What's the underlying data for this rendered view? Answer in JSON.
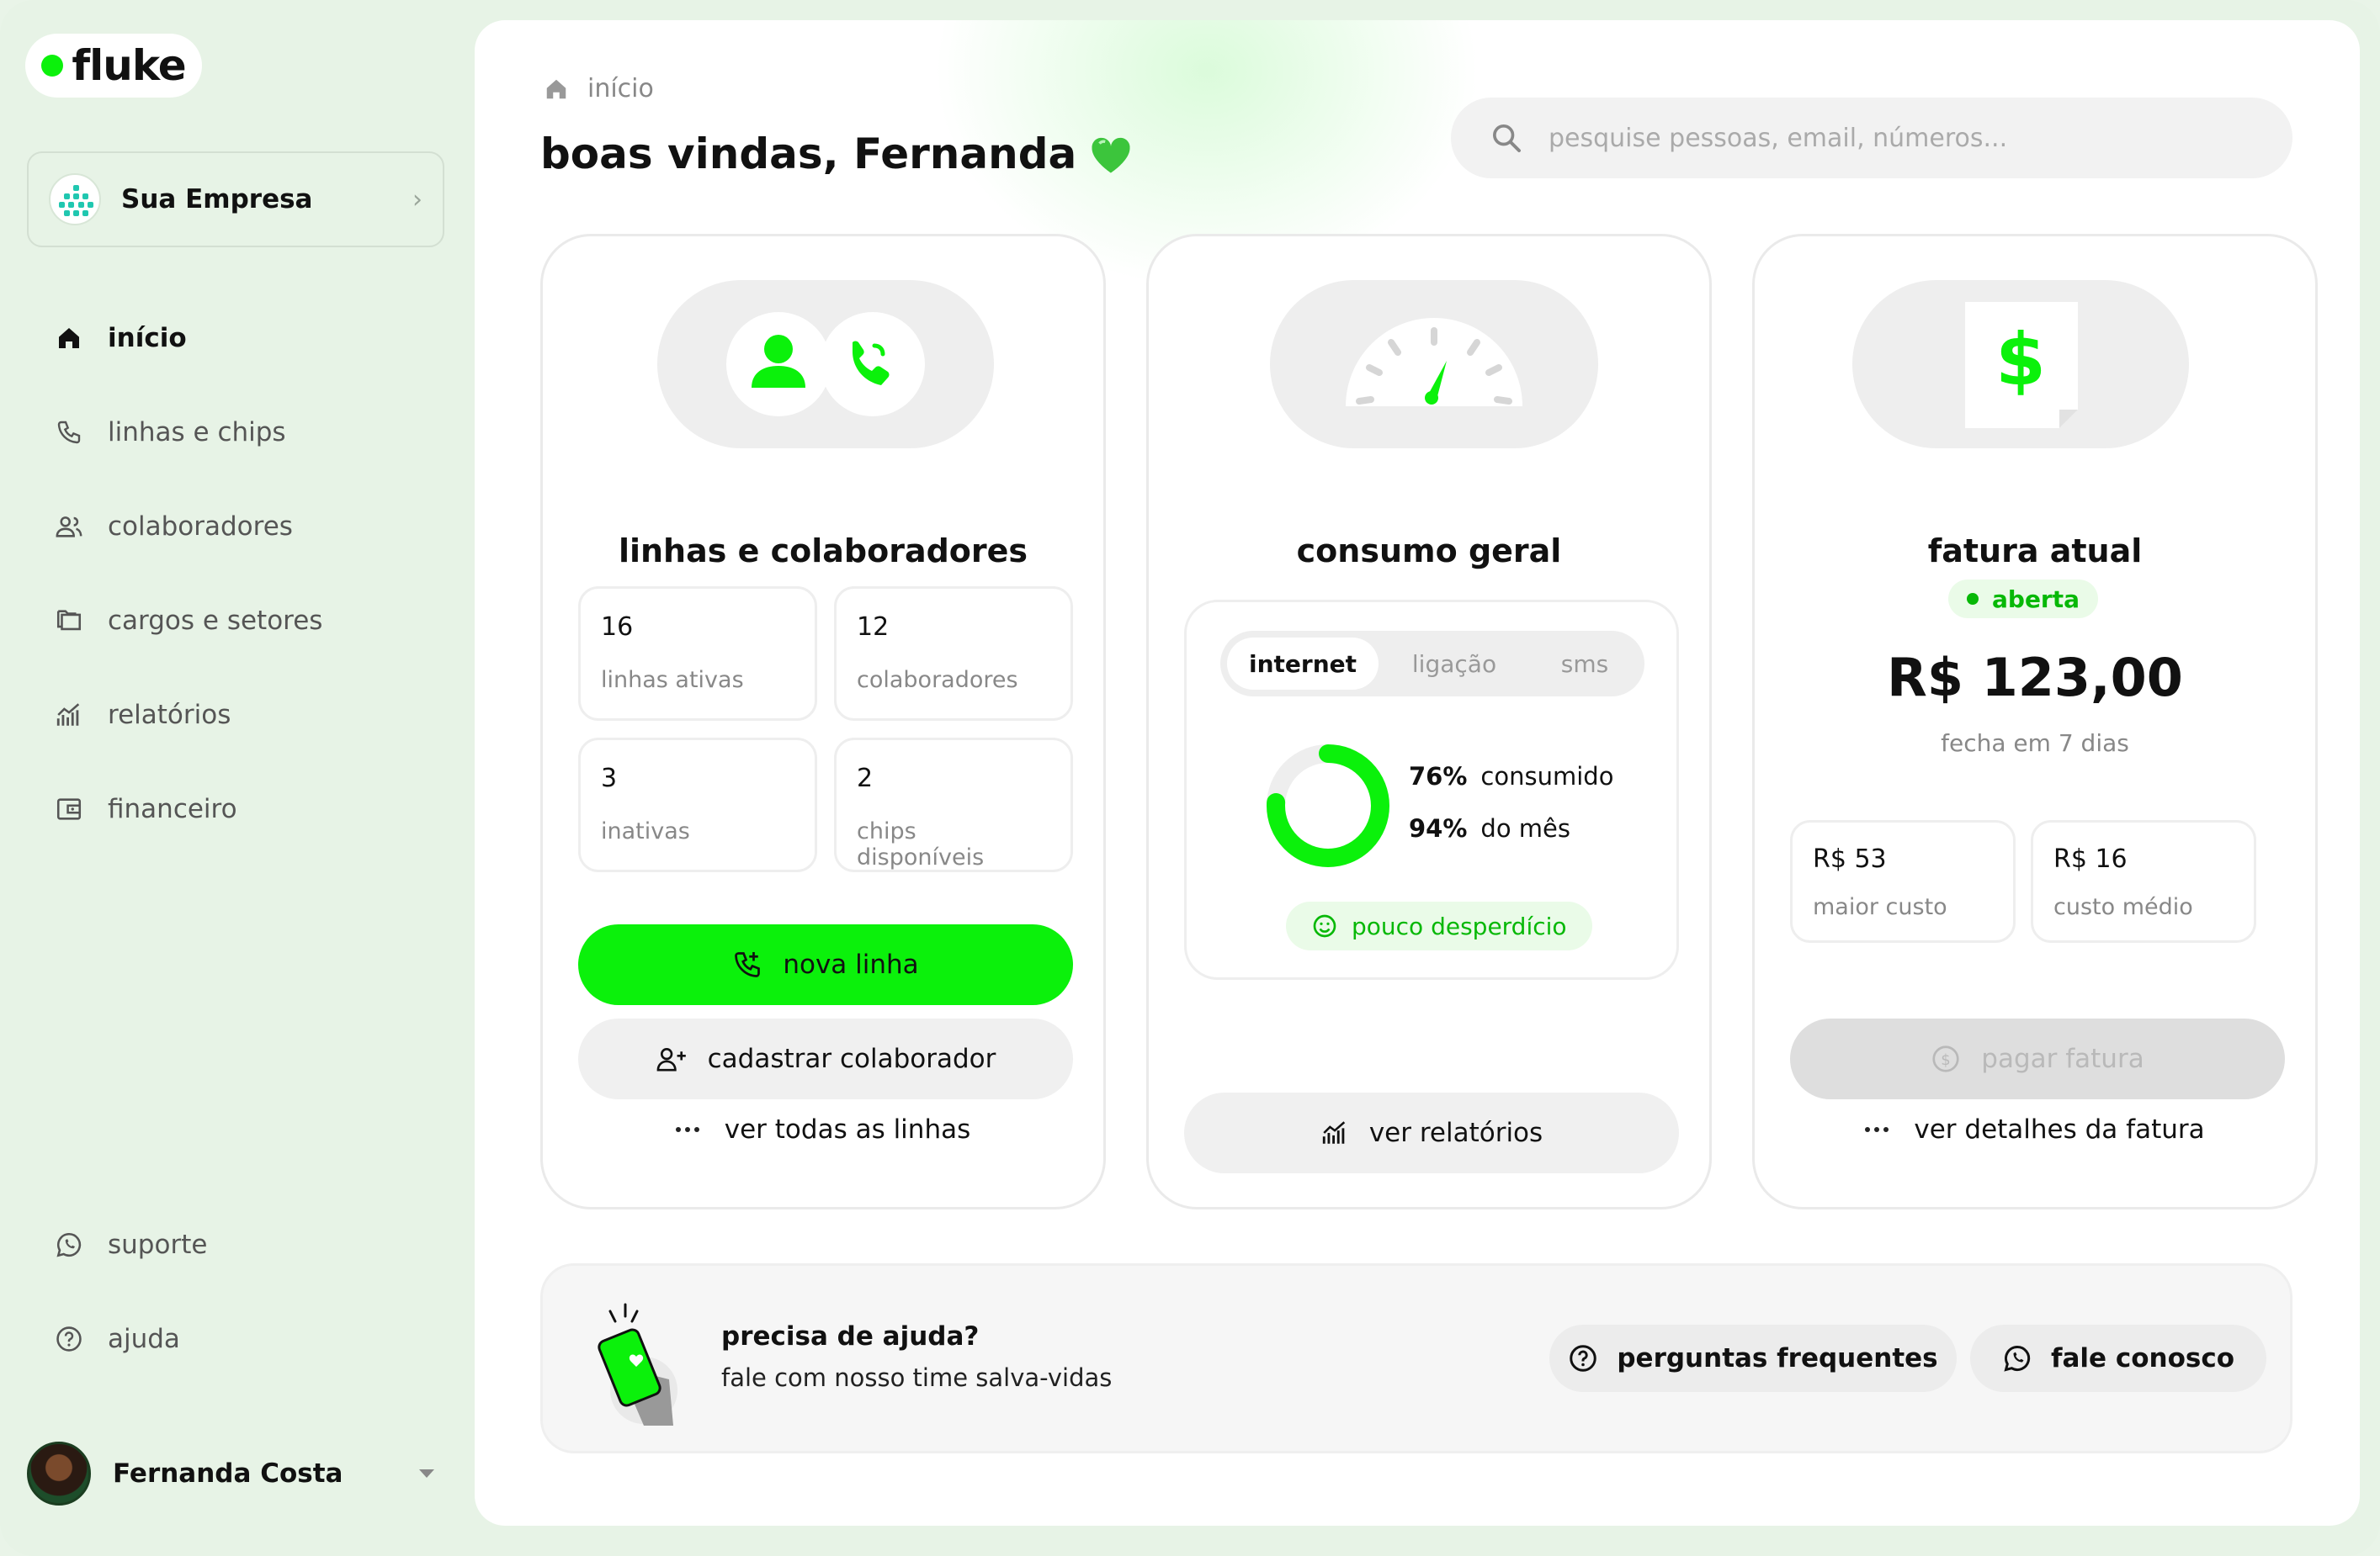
{
  "app": {
    "logo_text": "fluke"
  },
  "colors": {
    "accent": "#0bf10b",
    "accent_dark": "#07b807",
    "background": "#e7f3e6"
  },
  "sidebar": {
    "company": {
      "name": "Sua Empresa"
    },
    "items": [
      {
        "label": "início",
        "icon": "home-icon",
        "active": true
      },
      {
        "label": "linhas e chips",
        "icon": "phone-icon"
      },
      {
        "label": "colaboradores",
        "icon": "users-icon"
      },
      {
        "label": "cargos e setores",
        "icon": "folders-icon"
      },
      {
        "label": "relatórios",
        "icon": "chart-icon"
      },
      {
        "label": "financeiro",
        "icon": "wallet-icon"
      }
    ],
    "bottom_items": [
      {
        "label": "suporte",
        "icon": "whatsapp-icon"
      },
      {
        "label": "ajuda",
        "icon": "help-circle-icon"
      }
    ],
    "user": {
      "name": "Fernanda Costa"
    }
  },
  "header": {
    "breadcrumb": "início",
    "greeting": "boas vindas, Fernanda",
    "greeting_emoji": "💚",
    "search_placeholder": "pesquise pessoas, email, números..."
  },
  "cards": {
    "lines": {
      "title": "linhas e colaboradores",
      "stats": [
        {
          "value": "16",
          "label": "linhas ativas"
        },
        {
          "value": "12",
          "label": "colaboradores"
        },
        {
          "value": "3",
          "label": "inativas"
        },
        {
          "value": "2",
          "label": "chips disponíveis"
        }
      ],
      "primary_button": "nova linha",
      "secondary_button": "cadastrar colaborador",
      "link": "ver todas as linhas"
    },
    "usage": {
      "title": "consumo geral",
      "tabs": [
        "internet",
        "ligação",
        "sms"
      ],
      "active_tab": "internet",
      "consumed_pct": "76%",
      "consumed_label": "consumido",
      "month_pct": "94%",
      "month_label": "do mês",
      "ring_value": 0.76,
      "badge": "pouco desperdício",
      "button": "ver relatórios"
    },
    "invoice": {
      "title": "fatura atual",
      "status": "aberta",
      "currency": "R$",
      "amount": "123,00",
      "closes": "fecha em 7 dias",
      "stats": [
        {
          "value": "R$ 53",
          "label": "maior custo"
        },
        {
          "value": "R$ 16",
          "label": "custo médio"
        }
      ],
      "pay_button": "pagar fatura",
      "link": "ver detalhes da fatura"
    }
  },
  "help": {
    "title": "precisa de ajuda?",
    "subtitle": "fale com nosso time salva-vidas",
    "faq_button": "perguntas frequentes",
    "contact_button": "fale conosco"
  }
}
